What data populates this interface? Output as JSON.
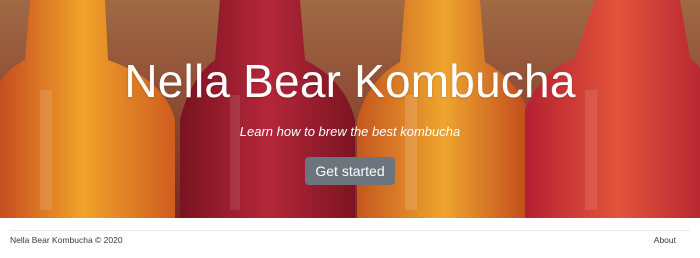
{
  "hero": {
    "title": "Nella Bear Kombucha",
    "tagline": "Learn how to brew the best kombucha",
    "cta_label": "Get started",
    "image_description_icon": "bottles-photo"
  },
  "footer": {
    "copyright": "Nella Bear Kombucha © 2020",
    "about_link": "About"
  },
  "colors": {
    "button_bg": "#6c757d",
    "button_text": "#ffffff",
    "footer_text": "#343a40"
  }
}
